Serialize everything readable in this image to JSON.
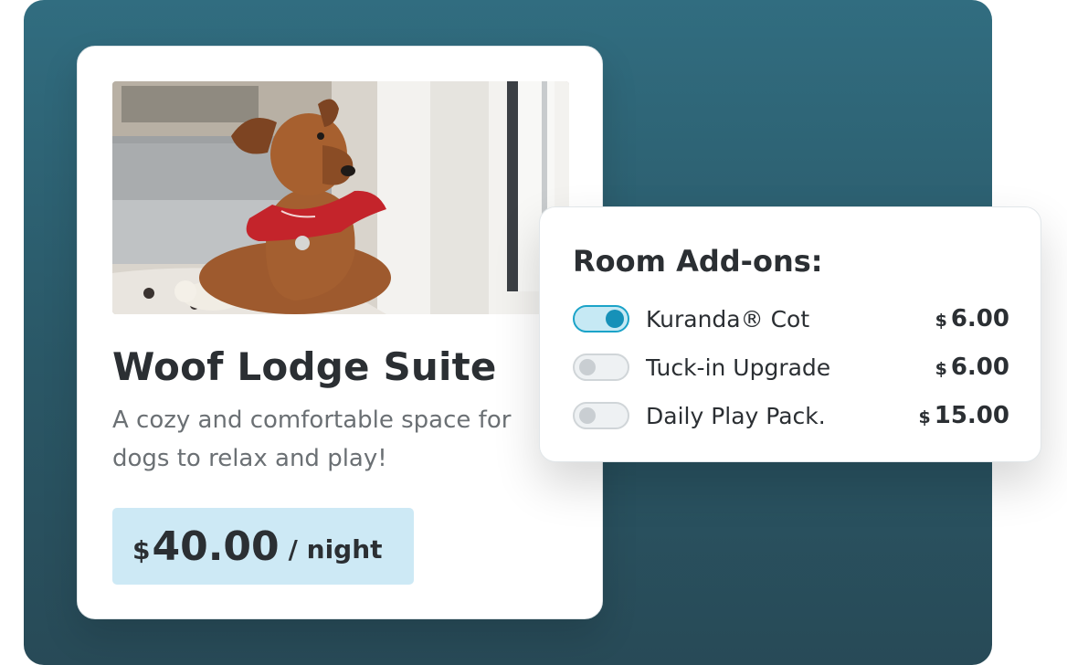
{
  "room": {
    "title": "Woof Lodge Suite",
    "description": "A cozy and comfortable space for dogs to relax and play!",
    "price_currency": "$",
    "price_amount": "40.00",
    "price_unit": "/ night",
    "photo_icon": "dog-photo"
  },
  "addons": {
    "title": "Room Add-ons:",
    "items": [
      {
        "label": "Kuranda® Cot",
        "currency": "$",
        "price": "6.00",
        "enabled": true
      },
      {
        "label": "Tuck-in Upgrade",
        "currency": "$",
        "price": "6.00",
        "enabled": false
      },
      {
        "label": "Daily Play Pack.",
        "currency": "$",
        "price": "15.00",
        "enabled": false
      }
    ]
  },
  "colors": {
    "backdrop": "#2f6577",
    "price_box": "#cde9f5",
    "toggle_on": "#1691b8",
    "text": "#2b2f33"
  }
}
